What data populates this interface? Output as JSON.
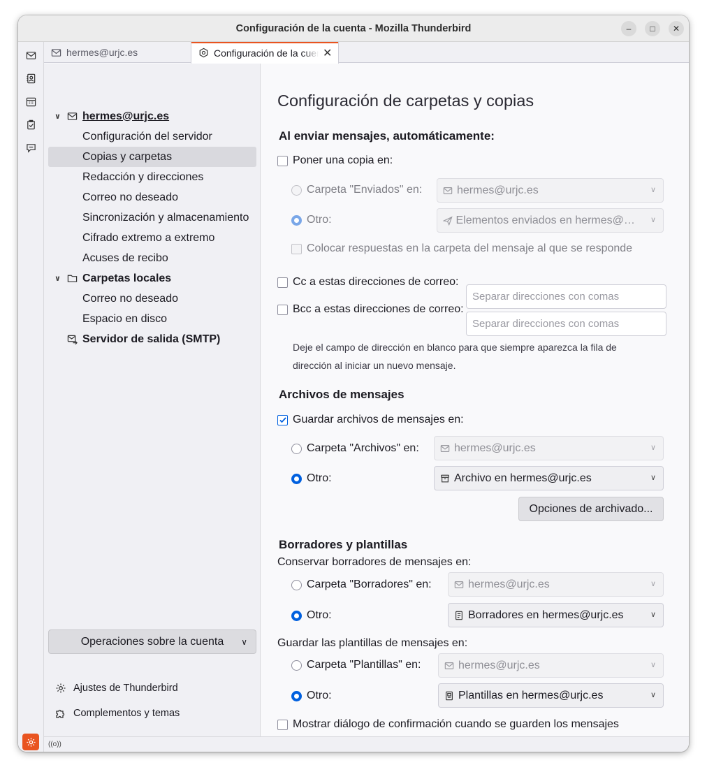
{
  "window": {
    "title": "Configuración de la cuenta - Mozilla Thunderbird",
    "controls": {
      "minimize": "–",
      "maximize": "□",
      "close": "✕"
    }
  },
  "spaces": [
    "mail-icon",
    "address-book-icon",
    "calendar-icon",
    "tasks-icon",
    "chat-icon"
  ],
  "tabs": [
    {
      "label": "hermes@urjc.es"
    },
    {
      "label": "Configuración de la cuenta"
    }
  ],
  "tree": {
    "account": {
      "label": "hermes@urjc.es",
      "children": [
        "Configuración del servidor",
        "Copias y carpetas",
        "Redacción y direcciones",
        "Correo no deseado",
        "Sincronización y almacenamiento",
        "Cifrado extremo a extremo",
        "Acuses de recibo"
      ]
    },
    "local": {
      "label": "Carpetas locales",
      "children": [
        "Correo no deseado",
        "Espacio en disco"
      ]
    },
    "smtp": {
      "label": "Servidor de salida (SMTP)"
    },
    "account_ops": "Operaciones sobre la cuenta",
    "links": {
      "settings": "Ajustes de Thunderbird",
      "addons": "Complementos y temas"
    }
  },
  "content": {
    "title": "Configuración de carpetas y copias",
    "sending": {
      "heading": "Al enviar mensajes, automáticamente:",
      "place_copy": "Poner una copia en:",
      "sent_folder": "Carpeta \"Enviados\" en:",
      "sent_folder_value": "hermes@urjc.es",
      "other": "Otro:",
      "other_value": "Elementos enviados en hermes@urjc.es",
      "reply_in_folder": "Colocar respuestas en la carpeta del mensaje al que se responde",
      "cc": "Cc a estas direcciones de correo:",
      "bcc": "Bcc a estas direcciones de correo:",
      "placeholder": "Separar direcciones con comas",
      "note_line1": "Deje el campo de dirección en blanco para que siempre aparezca la fila de",
      "note_line2": "dirección al iniciar un nuevo mensaje."
    },
    "archives": {
      "heading": "Archivos de mensajes",
      "keep": "Guardar archivos de mensajes en:",
      "folder": "Carpeta \"Archivos\" en:",
      "folder_value": "hermes@urjc.es",
      "other": "Otro:",
      "other_value": "Archivo en hermes@urjc.es",
      "options_button": "Opciones de archivado..."
    },
    "drafts": {
      "heading": "Borradores y plantillas",
      "keep_drafts": "Conservar borradores de mensajes en:",
      "drafts_folder": "Carpeta \"Borradores\" en:",
      "drafts_folder_value": "hermes@urjc.es",
      "other": "Otro:",
      "drafts_other_value": "Borradores en hermes@urjc.es",
      "keep_templates": "Guardar las plantillas de mensajes en:",
      "templates_folder": "Carpeta \"Plantillas\" en:",
      "templates_folder_value": "hermes@urjc.es",
      "templates_other_value": "Plantillas en hermes@urjc.es",
      "confirm_dialog": "Mostrar diálogo de confirmación cuando se guarden los mensajes"
    }
  },
  "status": {
    "activity_icon": "((o))"
  },
  "colors": {
    "accent": "#0060df",
    "brand": "#e95420"
  }
}
